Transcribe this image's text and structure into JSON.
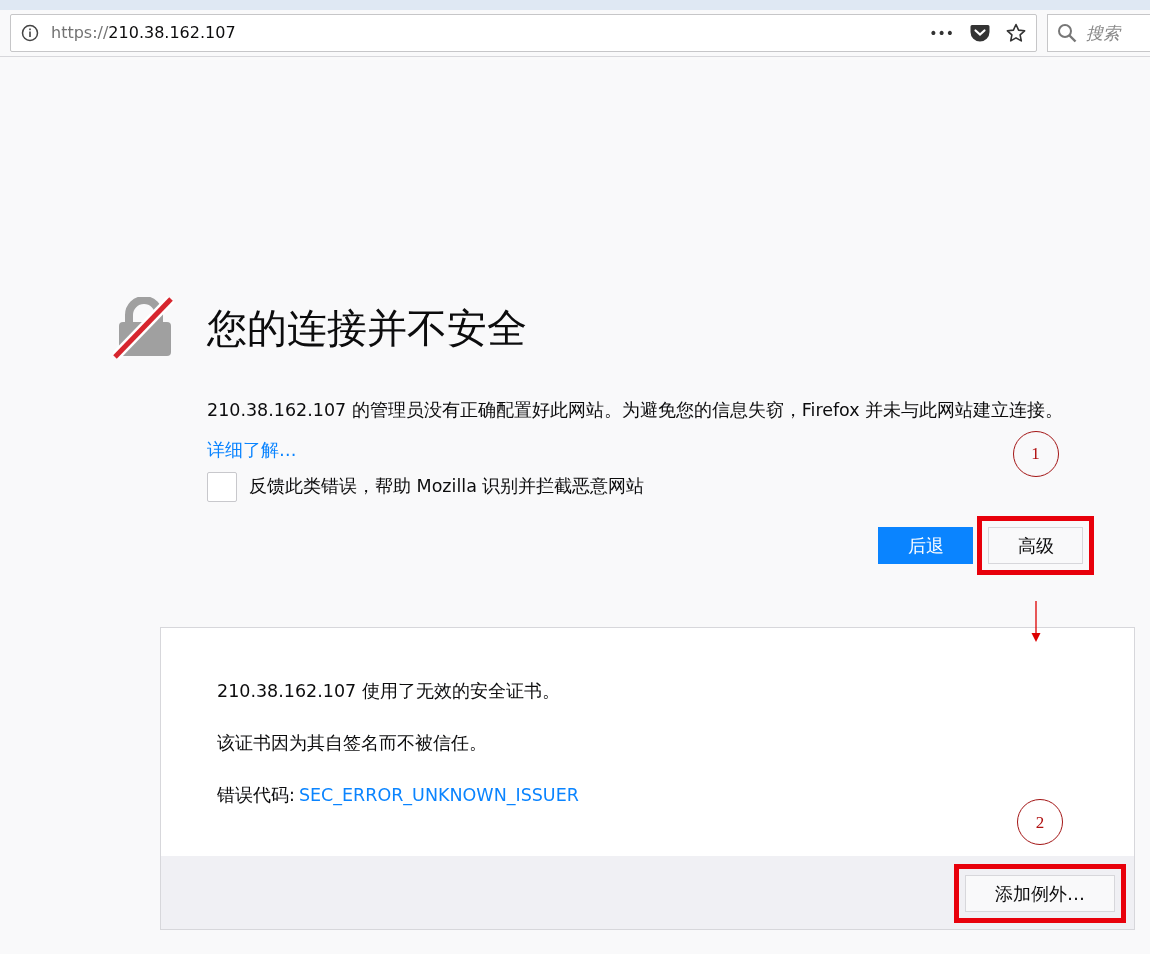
{
  "toolbar": {
    "url_scheme": "https://",
    "url_host": "210.38.162.107",
    "menu_glyph": "•••",
    "search_placeholder": "搜索"
  },
  "error": {
    "title": "您的连接并不安全",
    "description": "210.38.162.107 的管理员没有正确配置好此网站。为避免您的信息失窃，Firefox 并未与此网站建立连接。",
    "learn_more": "详细了解…",
    "report_checkbox": {
      "label": "反馈此类错误，帮助 Mozilla 识别并拦截恶意网站",
      "checked": false
    },
    "buttons": [
      {
        "label": "后退",
        "kind": "primary",
        "highlighted": false
      },
      {
        "label": "高级",
        "kind": "secondary",
        "highlighted": true,
        "callout": "1",
        "arrow_below": true
      }
    ]
  },
  "advanced": {
    "lines": [
      {
        "kind": "text",
        "text": "210.38.162.107 使用了无效的安全证书。"
      },
      {
        "kind": "text",
        "text": "该证书因为其自签名而不被信任。"
      },
      {
        "kind": "code",
        "label": "错误代码: ",
        "code": "SEC_ERROR_UNKNOWN_ISSUER"
      }
    ],
    "button": {
      "label": "添加例外…",
      "highlighted": true,
      "callout": "2"
    }
  }
}
